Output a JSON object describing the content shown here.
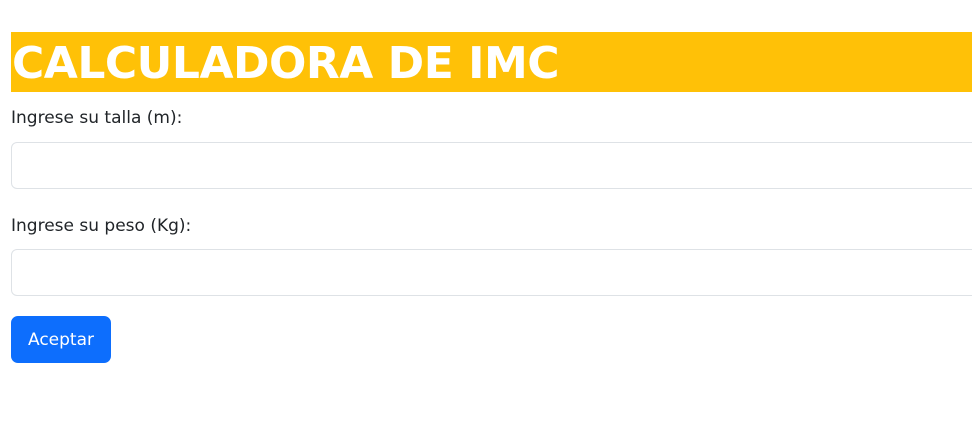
{
  "header": {
    "title": "CALCULADORA DE IMC"
  },
  "form": {
    "height_label": "Ingrese su talla (m):",
    "height_value": "",
    "weight_label": "Ingrese su peso (Kg):",
    "weight_value": "",
    "submit_label": "Aceptar"
  },
  "colors": {
    "banner": "#ffc107",
    "banner_text": "#ffffff",
    "button": "#0d6efd",
    "button_text": "#ffffff",
    "label_text": "#212529",
    "input_border": "#dee2e6"
  }
}
